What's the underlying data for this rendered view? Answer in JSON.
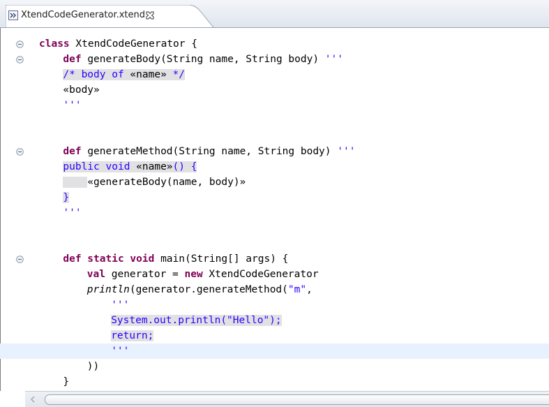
{
  "tab": {
    "label": "XtendCodeGenerator.xtend",
    "icon": "xtend-file-icon",
    "close_icon": "close-icon"
  },
  "editor": {
    "lines": [
      {
        "fold": true,
        "current": false,
        "indent": 0,
        "segments": [
          {
            "t": "class",
            "s": "kw"
          },
          {
            "t": " XtendCodeGenerator {"
          }
        ]
      },
      {
        "fold": true,
        "current": false,
        "indent": 4,
        "segments": [
          {
            "t": "def",
            "s": "kw"
          },
          {
            "t": " generateBody(String name, String body) "
          },
          {
            "t": "'''",
            "s": "tick"
          }
        ]
      },
      {
        "fold": false,
        "current": false,
        "indent": 4,
        "segments": [
          {
            "t": "/* body of ",
            "s": "tpl"
          },
          {
            "t": "«name»",
            "s": "tpl-plain"
          },
          {
            "t": " */",
            "s": "tpl"
          }
        ]
      },
      {
        "fold": false,
        "current": false,
        "indent": 4,
        "segments": [
          {
            "t": "«body»"
          }
        ]
      },
      {
        "fold": false,
        "current": false,
        "indent": 4,
        "segments": [
          {
            "t": "'''",
            "s": "tick"
          }
        ]
      },
      {
        "fold": false,
        "current": false,
        "indent": 0,
        "segments": []
      },
      {
        "fold": false,
        "current": false,
        "indent": 0,
        "segments": []
      },
      {
        "fold": true,
        "current": false,
        "indent": 4,
        "segments": [
          {
            "t": "def",
            "s": "kw"
          },
          {
            "t": " generateMethod(String name, String body) "
          },
          {
            "t": "'''",
            "s": "tick"
          }
        ]
      },
      {
        "fold": false,
        "current": false,
        "indent": 4,
        "segments": [
          {
            "t": "public void ",
            "s": "tpl"
          },
          {
            "t": "«name»",
            "s": "tpl-plain"
          },
          {
            "t": "() {",
            "s": "tpl"
          }
        ]
      },
      {
        "fold": false,
        "current": false,
        "indent": 4,
        "segments": [
          {
            "t": "    ",
            "s": "ws"
          },
          {
            "t": "«generateBody(name, body)»"
          }
        ]
      },
      {
        "fold": false,
        "current": false,
        "indent": 4,
        "segments": [
          {
            "t": "}",
            "s": "tpl"
          }
        ]
      },
      {
        "fold": false,
        "current": false,
        "indent": 4,
        "segments": [
          {
            "t": "'''",
            "s": "tick"
          }
        ]
      },
      {
        "fold": false,
        "current": false,
        "indent": 0,
        "segments": []
      },
      {
        "fold": false,
        "current": false,
        "indent": 0,
        "segments": []
      },
      {
        "fold": true,
        "current": false,
        "indent": 4,
        "segments": [
          {
            "t": "def static void",
            "s": "kw"
          },
          {
            "t": " main(String[] args) {"
          }
        ]
      },
      {
        "fold": false,
        "current": false,
        "indent": 8,
        "segments": [
          {
            "t": "val",
            "s": "kw"
          },
          {
            "t": " generator = "
          },
          {
            "t": "new",
            "s": "kw"
          },
          {
            "t": " XtendCodeGenerator"
          }
        ]
      },
      {
        "fold": false,
        "current": false,
        "indent": 8,
        "segments": [
          {
            "t": "println",
            "s": "ital"
          },
          {
            "t": "(generator.generateMethod("
          },
          {
            "t": "\"m\"",
            "s": "str"
          },
          {
            "t": ","
          }
        ]
      },
      {
        "fold": false,
        "current": false,
        "indent": 12,
        "segments": [
          {
            "t": "'''",
            "s": "tick"
          }
        ]
      },
      {
        "fold": false,
        "current": false,
        "indent": 12,
        "segments": [
          {
            "t": "System.out.println(\"Hello\");",
            "s": "tpl"
          }
        ]
      },
      {
        "fold": false,
        "current": false,
        "indent": 12,
        "segments": [
          {
            "t": "return;",
            "s": "tpl"
          }
        ]
      },
      {
        "fold": false,
        "current": true,
        "indent": 12,
        "segments": [
          {
            "t": "'''",
            "s": "tick"
          }
        ]
      },
      {
        "fold": false,
        "current": false,
        "indent": 8,
        "segments": [
          {
            "t": "))"
          }
        ]
      },
      {
        "fold": false,
        "current": false,
        "indent": 4,
        "segments": [
          {
            "t": "}"
          }
        ]
      },
      {
        "fold": false,
        "current": false,
        "indent": 0,
        "segments": [
          {
            "t": "}"
          }
        ]
      }
    ]
  },
  "colors": {
    "keyword": "#7f0055",
    "template_text": "#2a00ff",
    "template_background": "#e1e1e4",
    "current_line": "#e8f2fe"
  },
  "scrollbar": {
    "left_arrow_icon": "scroll-left-icon"
  }
}
